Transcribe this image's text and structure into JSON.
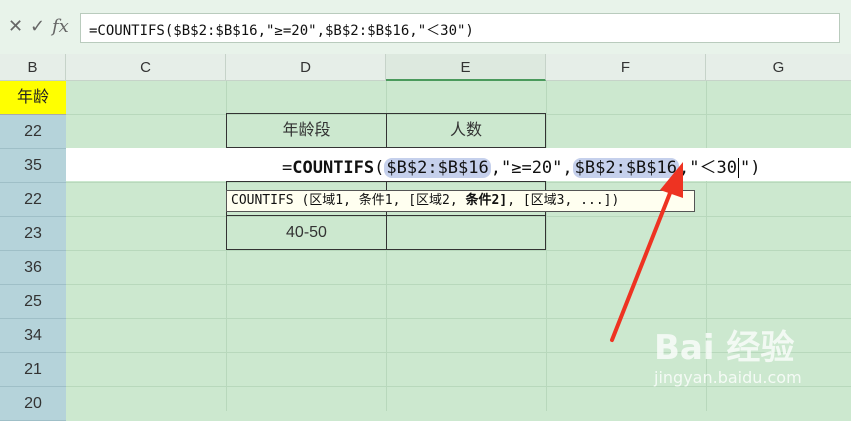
{
  "formula_bar": {
    "cancel_symbol": "✕",
    "confirm_symbol": "✓",
    "fx_label": "fx",
    "formula": "=COUNTIFS($B$2:$B$16,\"≥=20\",$B$2:$B$16,\"＜30\")"
  },
  "columns": [
    "B",
    "C",
    "D",
    "E",
    "F",
    "G"
  ],
  "row_header_title": "年龄",
  "ages": [
    "22",
    "35",
    "22",
    "23",
    "36",
    "25",
    "34",
    "21",
    "20"
  ],
  "table": {
    "header_age_range": "年龄段",
    "header_count": "人数",
    "row3_age_range": "40-50"
  },
  "edit": {
    "prefix": "=",
    "function_name": "COUNTIFS",
    "open_paren": "(",
    "range1": "$B$2:$B$16",
    "cond1": ",\"≥=20\",",
    "range2": "$B$2:$B$16",
    "cond2_before_caret": ",\"＜30",
    "cond2_after_caret": "\")"
  },
  "tooltip": {
    "part1": "COUNTIFS (区域1, 条件1, [区域2, ",
    "bold": "条件2]",
    "part2": ", [区域3, ...])"
  },
  "watermark": {
    "brand": "Bai 经验",
    "url": "jingyan.baidu.com"
  },
  "colors": {
    "sheet_bg": "#cce8cf",
    "row_header": "#b5d3da",
    "title_cell": "#ffff00",
    "range_highlight": "#c5d0ec",
    "arrow": "#ee3322"
  },
  "icons": [
    "cancel-icon",
    "confirm-icon",
    "fx-icon",
    "red-arrow-icon"
  ]
}
